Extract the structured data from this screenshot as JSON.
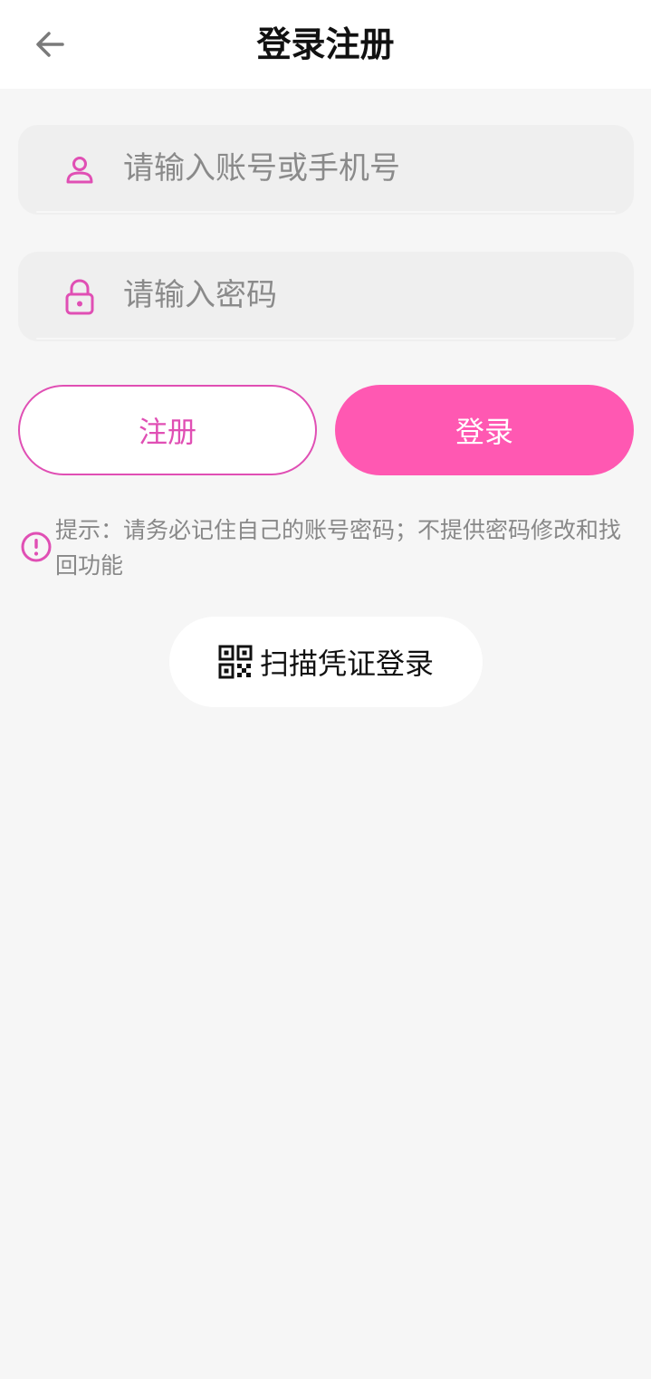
{
  "header": {
    "title": "登录注册",
    "back_icon": "arrow-left-icon"
  },
  "form": {
    "account_placeholder": "请输入账号或手机号",
    "password_placeholder": "请输入密码",
    "account_icon": "user-icon",
    "password_icon": "lock-icon"
  },
  "buttons": {
    "register_label": "注册",
    "login_label": "登录"
  },
  "tip": {
    "icon": "alert-circle-icon",
    "text": "提示：请务必记住自己的账号密码；不提供密码修改和找回功能"
  },
  "scan": {
    "icon": "qr-code-icon",
    "label": "扫描凭证登录"
  },
  "colors": {
    "accent": "#ff58b2",
    "accent_border": "#e04fb4",
    "background": "#f6f6f6",
    "field_bg": "#efefef"
  }
}
